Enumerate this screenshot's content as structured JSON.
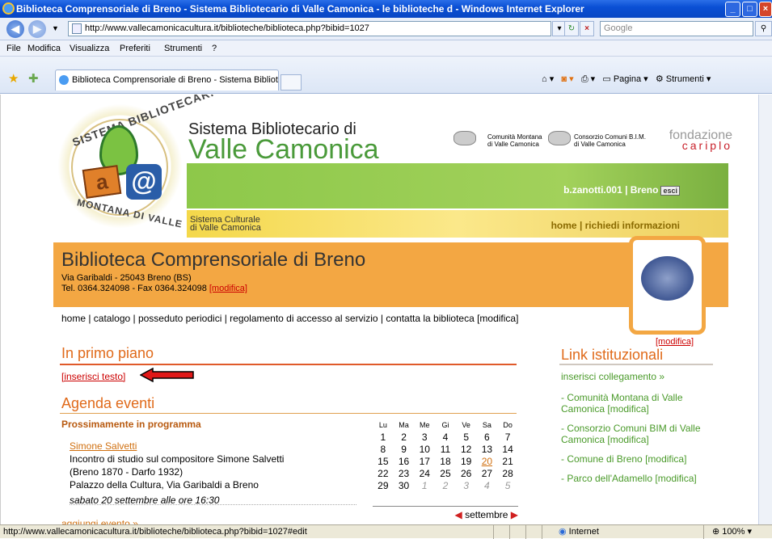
{
  "window": {
    "title": "Biblioteca Comprensoriale di Breno - Sistema Bibliotecario di Valle Camonica - le biblioteche d - Windows Internet Explorer"
  },
  "address_bar": {
    "url": "http://www.vallecamonicacultura.it/biblioteche/biblioteca.php?bibid=1027",
    "search_placeholder": "Google"
  },
  "menu": [
    "File",
    "Modifica",
    "Visualizza",
    "Preferiti",
    "Strumenti",
    "?"
  ],
  "tab": {
    "label": "Biblioteca Comprensoriale di Breno - Sistema Biblioteca..."
  },
  "toolbar_right": {
    "pagina": "Pagina",
    "strumenti": "Strumenti"
  },
  "header": {
    "logo_top": "SISTEMA BIBLIOTECARIO",
    "logo_bottom": "MONTANA DI VALLE",
    "title_line1": "Sistema Bibliotecario di",
    "title_line2": "Valle Camonica",
    "partner1_l1": "Comunità Montana",
    "partner1_l2": "di Valle Camonica",
    "partner2_l1": "Consorzio Comuni B.I.M.",
    "partner2_l2": "di Valle Camonica",
    "fondazione": "fondazione",
    "cariplo": "cariplo",
    "user": "b.zanotti.001 | Breno",
    "logout": "esci",
    "culturale_l1": "Sistema Culturale",
    "culturale_l2": "di Valle Camonica",
    "link_home": "home",
    "link_sep": " | ",
    "link_info": "richiedi informazioni"
  },
  "library": {
    "name": "Biblioteca Comprensoriale di Breno",
    "address": "Via Garibaldi - 25043 Breno (BS)",
    "phone": "Tel. 0364.324098 - Fax 0364.324098 ",
    "edit": "[modifica]",
    "crest_edit": "[modifica]"
  },
  "topnav": "home | catalogo | posseduto periodici | regolamento di accesso al servizio | contatta la biblioteca [modifica]",
  "primo_piano": {
    "title": "In primo piano",
    "insert": "[inserisci testo]"
  },
  "agenda": {
    "title": "Agenda eventi",
    "subtitle": "Prossimamente in programma",
    "event_name": "Simone Salvetti",
    "event_l1": "Incontro di studio sul compositore Simone Salvetti",
    "event_l2": "(Breno 1870 - Darfo 1932)",
    "event_l3": "Palazzo della Cultura, Via Garibaldi a Breno",
    "event_date": "sabato 20 settembre alle ore 16:30",
    "add_event": "aggiungi evento »"
  },
  "calendar": {
    "days": [
      "Lu",
      "Ma",
      "Me",
      "Gi",
      "Ve",
      "Sa",
      "Do"
    ],
    "weeks": [
      [
        "1",
        "2",
        "3",
        "4",
        "5",
        "6",
        "7"
      ],
      [
        "8",
        "9",
        "10",
        "11",
        "12",
        "13",
        "14"
      ],
      [
        "15",
        "16",
        "17",
        "18",
        "19",
        "20",
        "21"
      ],
      [
        "22",
        "23",
        "24",
        "25",
        "26",
        "27",
        "28"
      ],
      [
        "29",
        "30",
        "1",
        "2",
        "3",
        "4",
        "5"
      ]
    ],
    "month": "settembre",
    "highlight": "20"
  },
  "links": {
    "title": "Link istituzionali",
    "insert": "inserisci collegamento »",
    "items": [
      {
        "label": "- Comunità Montana di Valle Camonica",
        "edit": "[modifica]"
      },
      {
        "label": "- Consorzio Comuni BIM di Valle Camonica",
        "edit": "[modifica]"
      },
      {
        "label": "- Comune di Breno",
        "edit": "[modifica]"
      },
      {
        "label": "- Parco dell'Adamello",
        "edit": "[modifica]"
      }
    ]
  },
  "status": {
    "url": "http://www.vallecamonicacultura.it/biblioteche/biblioteca.php?bibid=1027#edit",
    "zone": "Internet",
    "zoom": "100%"
  }
}
